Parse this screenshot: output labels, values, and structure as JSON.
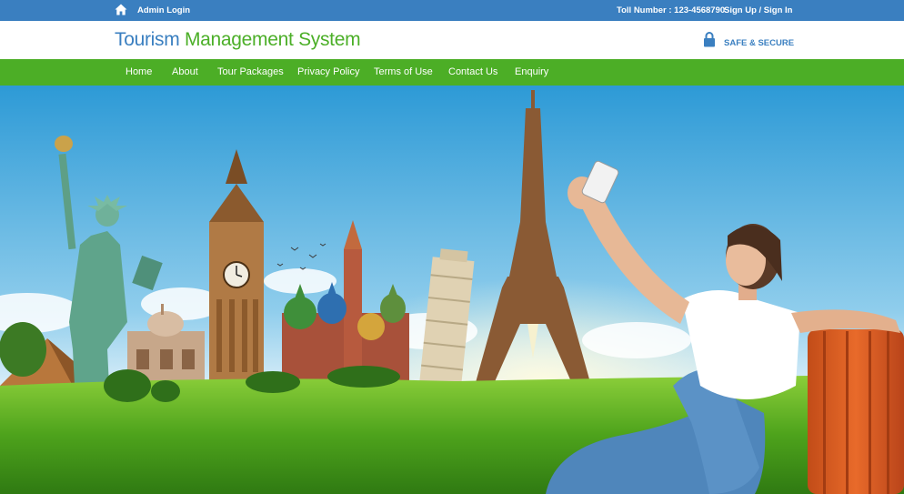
{
  "topbar": {
    "admin_login": "Admin Login",
    "toll_number": "Toll Number : 123-4568790",
    "signup": "Sign Up / Sign In",
    "home_icon": "home-icon"
  },
  "header": {
    "brand_part1": "Tourism",
    "brand_part2": "Management System",
    "safe_secure": "SAFE & SECURE",
    "lock_icon": "lock-icon"
  },
  "nav": {
    "items": [
      "Home",
      "About",
      "Tour Packages",
      "Privacy Policy",
      "Terms of Use",
      "Contact Us",
      "Enquiry"
    ]
  },
  "colors": {
    "topbar": "#3a7fc0",
    "brand_blue": "#3a7fc0",
    "brand_green": "#4caf28",
    "nav": "#4cae26"
  }
}
